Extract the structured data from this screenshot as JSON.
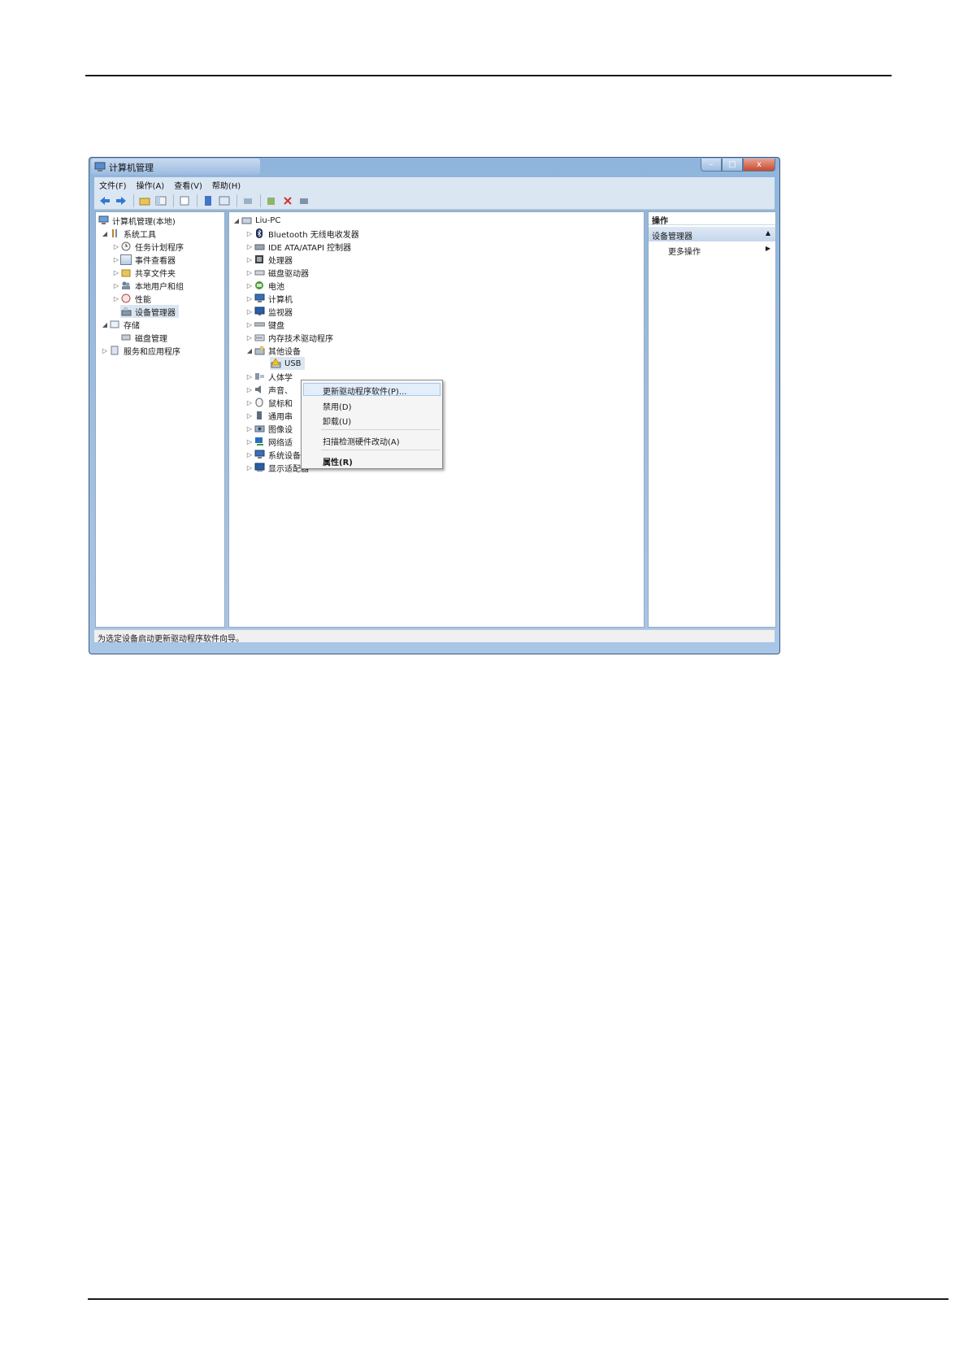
{
  "window": {
    "title": "计算机管理",
    "buttons": {
      "minimize": "–",
      "maximize": "□",
      "close": "x"
    }
  },
  "menu": [
    "文件(F)",
    "操作(A)",
    "查看(V)",
    "帮助(H)"
  ],
  "left_tree": [
    {
      "label": "计算机管理(本地)",
      "icon": "computer-icon"
    },
    {
      "label": "系统工具",
      "icon": "tools-icon"
    },
    {
      "label": "任务计划程序",
      "icon": "clock-icon"
    },
    {
      "label": "事件查看器",
      "icon": "event-icon"
    },
    {
      "label": "共享文件夹",
      "icon": "folder-icon"
    },
    {
      "label": "本地用户和组",
      "icon": "users-icon"
    },
    {
      "label": "性能",
      "icon": "performance-icon"
    },
    {
      "label": "设备管理器",
      "icon": "device-manager-icon"
    },
    {
      "label": "存储",
      "icon": "storage-icon"
    },
    {
      "label": "磁盘管理",
      "icon": "disk-icon"
    },
    {
      "label": "服务和应用程序",
      "icon": "services-icon"
    }
  ],
  "device_tree": [
    {
      "label": "Liu-PC",
      "icon": "pc-icon"
    },
    {
      "label": "Bluetooth 无线电收发器",
      "icon": "bluetooth-icon"
    },
    {
      "label": "IDE ATA/ATAPI 控制器",
      "icon": "ide-icon"
    },
    {
      "label": "处理器",
      "icon": "cpu-icon"
    },
    {
      "label": "磁盘驱动器",
      "icon": "drive-icon"
    },
    {
      "label": "电池",
      "icon": "battery-icon"
    },
    {
      "label": "计算机",
      "icon": "computer-icon"
    },
    {
      "label": "监视器",
      "icon": "monitor-icon"
    },
    {
      "label": "键盘",
      "icon": "keyboard-icon"
    },
    {
      "label": "内存技术驱动程序",
      "icon": "memory-icon"
    },
    {
      "label": "其他设备",
      "icon": "other-devices-icon"
    },
    {
      "label": "USB",
      "icon": "warning-device-icon"
    },
    {
      "label": "人体学",
      "icon": "hid-icon"
    },
    {
      "label": "声音、",
      "icon": "sound-icon"
    },
    {
      "label": "鼠标和",
      "icon": "mouse-icon"
    },
    {
      "label": "通用串",
      "icon": "usb-icon"
    },
    {
      "label": "图像设",
      "icon": "imaging-icon"
    },
    {
      "label": "网络适",
      "icon": "network-icon"
    },
    {
      "label": "系统设备",
      "icon": "system-icon"
    },
    {
      "label": "显示适配器",
      "icon": "display-icon"
    }
  ],
  "context_menu": {
    "update_driver": "更新驱动程序软件(P)...",
    "disable": "禁用(D)",
    "uninstall": "卸载(U)",
    "scan": "扫描检测硬件改动(A)",
    "properties": "属性(R)"
  },
  "actions_pane": {
    "header": "操作",
    "section": "设备管理器",
    "more": "更多操作"
  },
  "status": "为选定设备启动更新驱动程序软件向导。"
}
